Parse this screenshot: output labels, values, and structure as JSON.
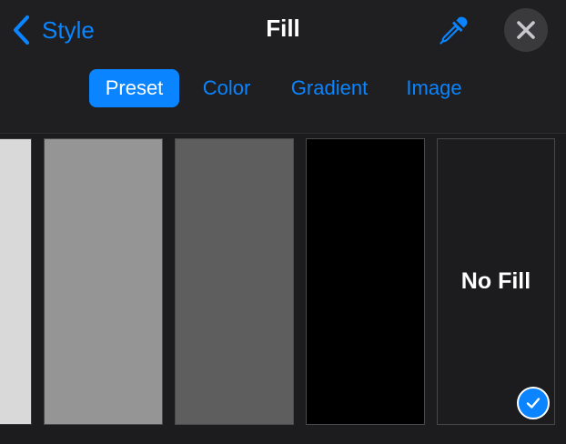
{
  "header": {
    "back_label": "Style",
    "title": "Fill"
  },
  "icons": {
    "back": "chevron-left-icon",
    "eyedropper": "eyedropper-icon",
    "close": "close-icon",
    "check": "checkmark-icon"
  },
  "tabs": [
    {
      "label": "Preset",
      "active": true
    },
    {
      "label": "Color",
      "active": false
    },
    {
      "label": "Gradient",
      "active": false
    },
    {
      "label": "Image",
      "active": false
    }
  ],
  "swatches": [
    {
      "name": "light-gray",
      "color": "#d9d9d9"
    },
    {
      "name": "gray",
      "color": "#959595"
    },
    {
      "name": "dark-gray",
      "color": "#5e5e5e"
    },
    {
      "name": "black",
      "color": "#000000"
    },
    {
      "name": "no-fill",
      "color": "#1c1c1e",
      "label": "No Fill",
      "selected": true
    }
  ],
  "colors": {
    "accent": "#0a84ff",
    "background": "#1f1f21",
    "close_bg": "#3a3a3c"
  }
}
